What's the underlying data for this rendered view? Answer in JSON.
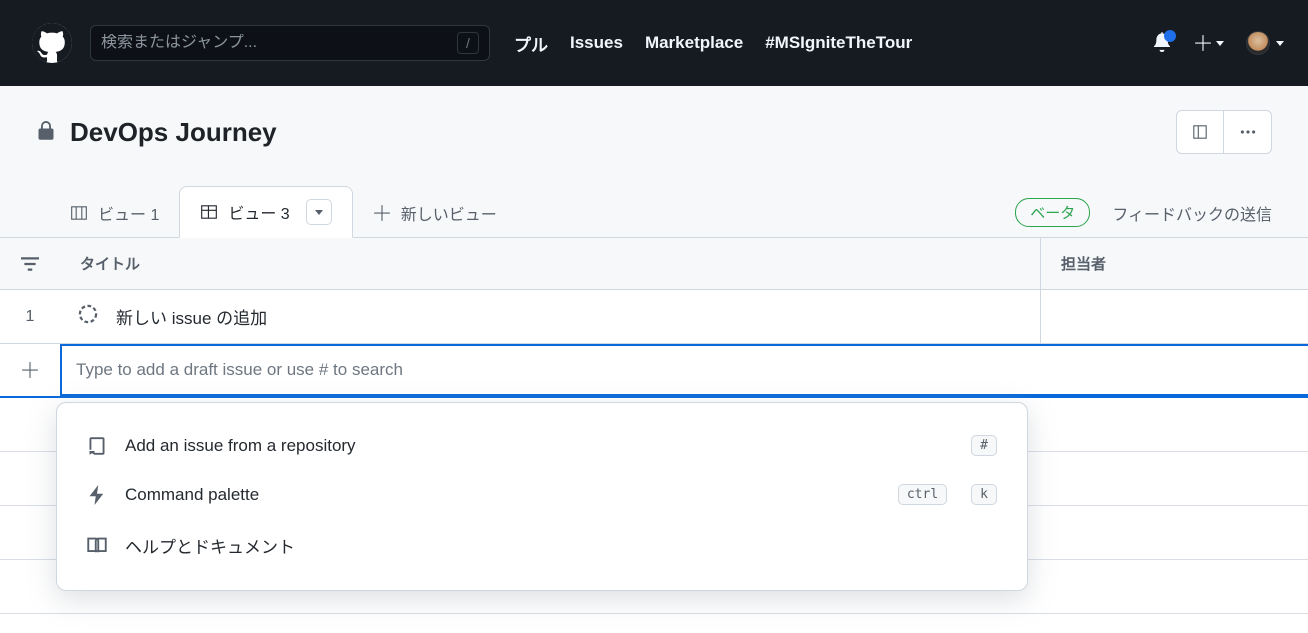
{
  "header": {
    "search_placeholder": "検索またはジャンプ...",
    "slash_hint": "/",
    "nav": {
      "pull": "プル",
      "issues": "Issues",
      "marketplace": "Marketplace",
      "hashtag": "#MSIgniteTheTour"
    }
  },
  "project": {
    "title": "DevOps Journey"
  },
  "tabs": {
    "view1": "ビュー 1",
    "view3": "ビュー 3",
    "new_view": "新しいビュー",
    "beta": "ベータ",
    "feedback": "フィードバックの送信"
  },
  "columns": {
    "title": "タイトル",
    "assignee": "担当者"
  },
  "rows": [
    {
      "num": "1",
      "title": "新しい issue の追加"
    }
  ],
  "add_input_placeholder": "Type to add a draft issue or use # to search",
  "dropdown": {
    "add_from_repo": "Add an issue from a repository",
    "add_from_repo_key": "#",
    "command_palette": "Command palette",
    "command_palette_keys": [
      "ctrl",
      "k"
    ],
    "help_docs": "ヘルプとドキュメント"
  }
}
